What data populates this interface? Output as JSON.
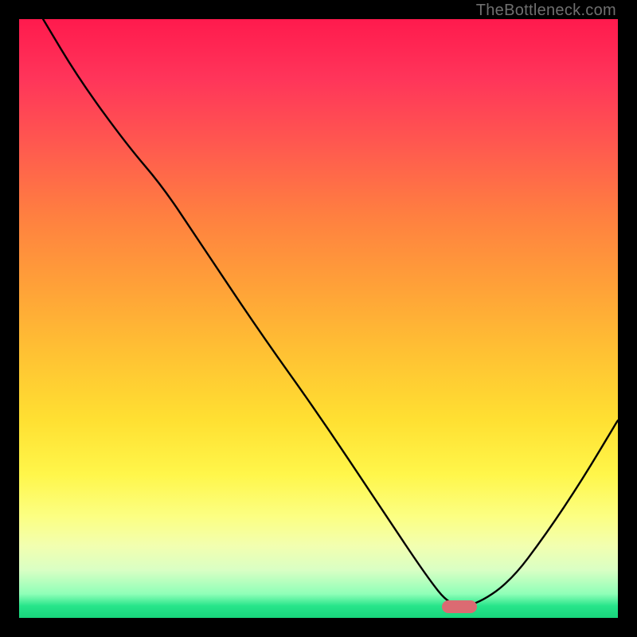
{
  "watermark": "TheBottleneck.com",
  "marker": {
    "x_frac": 0.735,
    "y_frac": 0.982
  },
  "chart_data": {
    "type": "line",
    "title": "",
    "xlabel": "",
    "ylabel": "",
    "xlim": [
      0,
      1
    ],
    "ylim": [
      0,
      1
    ],
    "series": [
      {
        "name": "bottleneck-curve",
        "x": [
          0.04,
          0.1,
          0.18,
          0.24,
          0.3,
          0.4,
          0.5,
          0.6,
          0.68,
          0.72,
          0.76,
          0.82,
          0.88,
          0.94,
          1.0
        ],
        "y": [
          1.0,
          0.9,
          0.79,
          0.72,
          0.63,
          0.48,
          0.34,
          0.19,
          0.07,
          0.02,
          0.02,
          0.06,
          0.14,
          0.23,
          0.33
        ]
      }
    ],
    "optimum_marker": {
      "x": 0.735,
      "y": 0.018
    }
  }
}
